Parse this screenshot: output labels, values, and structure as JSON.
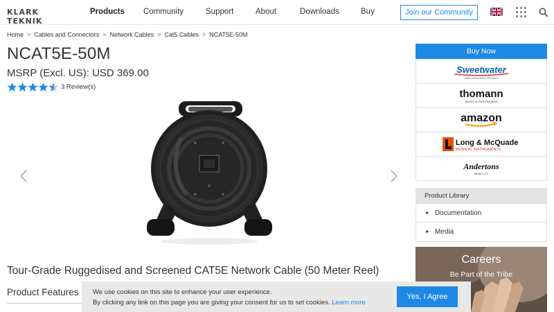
{
  "header": {
    "logo_text": "KLARK TEKNIK",
    "nav": [
      {
        "label": "Products",
        "active": true
      },
      {
        "label": "Community",
        "active": false
      },
      {
        "label": "Support",
        "active": false
      },
      {
        "label": "About",
        "active": false
      },
      {
        "label": "Downloads",
        "active": false
      },
      {
        "label": "Buy",
        "active": false
      }
    ],
    "join_label": "Join our Community",
    "icons": [
      "uk-flag-icon",
      "apps-grid-icon",
      "search-icon"
    ]
  },
  "breadcrumb": [
    "Home",
    "Cables and Connectors",
    "Network Cables",
    "Cat5 Cables",
    "NCAT5E-50M"
  ],
  "product": {
    "title": "NCAT5E-50M",
    "price": "MSRP (Excl. US): USD 369.00",
    "rating": 4.5,
    "rating_max": 5,
    "reviews": "3 Review(s)",
    "description": "Tour-Grade Ruggedised and Screened CAT5E Network Cable (50 Meter Reel)",
    "features_heading": "Product Features"
  },
  "sidebar": {
    "buy_now": "Buy Now",
    "retailers": [
      {
        "name": "Sweetwater",
        "tagline": "Music Instruments & Pro Audio"
      },
      {
        "name": "thomann",
        "tagline": "MUSIC IS OUR PASSION"
      },
      {
        "name": "amazon",
        "tagline": ""
      },
      {
        "name": "Long & McQuade",
        "tagline": "MUSICAL INSTRUMENTS"
      },
      {
        "name": "Andertons",
        "tagline": "MUSIC CO."
      }
    ],
    "library_heading": "Product Library",
    "library_items": [
      "Documentation",
      "Media"
    ],
    "careers_title": "Careers",
    "careers_subtitle": "Be Part of the Tribe"
  },
  "cookie": {
    "line1": "We use cookies on this site to enhance your user experience.",
    "line2": "By clicking any link on this page you are giving your consent for us to set cookies.",
    "learn_more": "Learn more",
    "accept": "Yes, I Agree"
  },
  "colors": {
    "accent": "#1e88e5",
    "star": "#1e88e5",
    "cookie_bg": "#e8e8e8"
  }
}
